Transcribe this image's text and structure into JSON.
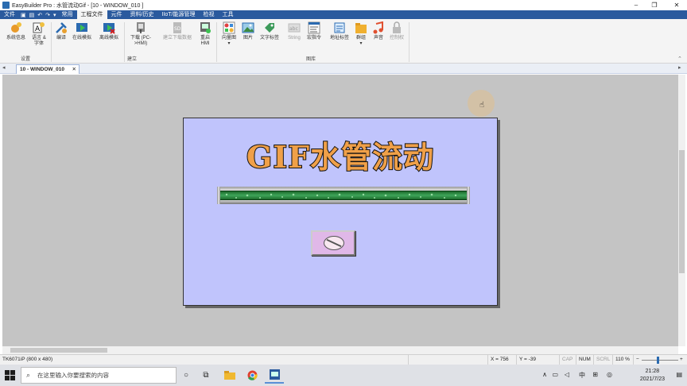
{
  "window": {
    "title": "EasyBuilder Pro : 水管流动Gif - [10 - WINDOW_010 ]",
    "minimize": "–",
    "restore": "❐",
    "close": "✕"
  },
  "menu": {
    "file": "文件",
    "tabs": [
      "常用",
      "工程文件",
      "元件",
      "资料/历史",
      "IIoT/能源管理",
      "检视",
      "工具"
    ],
    "active_index": 1
  },
  "ribbon": {
    "buttons": [
      {
        "label1": "系统信息",
        "label2": "",
        "icon": "system-info-icon",
        "disabled": false
      },
      {
        "label1": "语言 &",
        "label2": "字体",
        "icon": "language-font-icon",
        "disabled": false
      },
      {
        "label1": "编译",
        "label2": "",
        "icon": "compile-icon",
        "disabled": false
      },
      {
        "label1": "在线模拟",
        "label2": "",
        "icon": "online-sim-icon",
        "disabled": false
      },
      {
        "label1": "离线模拟",
        "label2": "",
        "icon": "offline-sim-icon",
        "disabled": false
      },
      {
        "label1": "下载 (PC-",
        "label2": ">HMI)",
        "icon": "download-icon",
        "disabled": false
      },
      {
        "label1": "建立下载数据",
        "label2": "",
        "icon": "sd-card-icon",
        "disabled": true
      },
      {
        "label1": "重启",
        "label2": "HMI",
        "icon": "restart-hmi-icon",
        "disabled": false
      },
      {
        "label1": "向量图",
        "label2": "▾",
        "icon": "vector-icon",
        "disabled": false
      },
      {
        "label1": "图片",
        "label2": "",
        "icon": "picture-icon",
        "disabled": false
      },
      {
        "label1": "文字标签",
        "label2": "",
        "icon": "tag-icon",
        "disabled": false
      },
      {
        "label1": "String",
        "label2": "",
        "icon": "string-icon",
        "disabled": true
      },
      {
        "label1": "宏指令",
        "label2": "",
        "icon": "macro-icon",
        "disabled": false
      },
      {
        "label1": "地址标签",
        "label2": "",
        "icon": "address-tag-icon",
        "disabled": false
      },
      {
        "label1": "群组",
        "label2": "▾",
        "icon": "group-icon",
        "disabled": false
      },
      {
        "label1": "声音",
        "label2": "",
        "icon": "sound-icon",
        "disabled": false
      },
      {
        "label1": "控制权",
        "label2": "",
        "icon": "lock-icon",
        "disabled": true
      }
    ],
    "groups": [
      "设置",
      "建立",
      "图库"
    ]
  },
  "doc_tab": {
    "label": "10 - WINDOW_010",
    "close": "✕"
  },
  "hmi": {
    "title": "GIF水管流动"
  },
  "statusbar": {
    "device": "TK6071iP (800 x 480)",
    "x": "X = 756",
    "y": "Y = -39",
    "cap": "CAP",
    "num": "NUM",
    "scrl": "SCRL",
    "zoom": "110 %"
  },
  "taskbar": {
    "search_placeholder": "在这里输入你要搜索的内容",
    "ime": "中",
    "time": "21:28",
    "date": "2021/7/23"
  },
  "colors": {
    "menu_bg": "#2a5a9e",
    "hmi_bg": "#c0c4fc",
    "title_fill": "#f0a048",
    "pipe_green": "#3ea55a",
    "canvas_bg": "#c4c4c4"
  }
}
